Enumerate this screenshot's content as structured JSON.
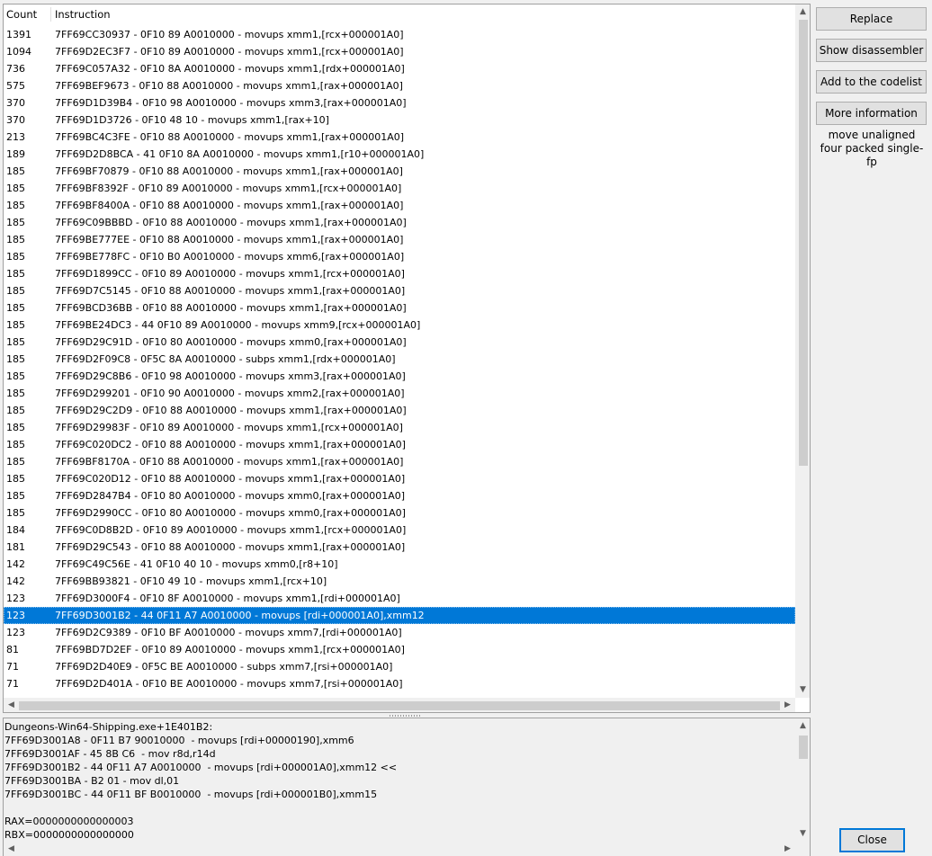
{
  "list": {
    "headers": {
      "count": "Count",
      "instruction": "Instruction"
    },
    "rows": [
      {
        "count": "1391",
        "instruction": "7FF69CC30937 - 0F10 89 A0010000  - movups xmm1,[rcx+000001A0]"
      },
      {
        "count": "1094",
        "instruction": "7FF69D2EC3F7 - 0F10 89 A0010000  - movups xmm1,[rcx+000001A0]"
      },
      {
        "count": "736",
        "instruction": "7FF69C057A32 - 0F10 8A A0010000  - movups xmm1,[rdx+000001A0]"
      },
      {
        "count": "575",
        "instruction": "7FF69BEF9673 - 0F10 88 A0010000  - movups xmm1,[rax+000001A0]"
      },
      {
        "count": "370",
        "instruction": "7FF69D1D39B4 - 0F10 98 A0010000  - movups xmm3,[rax+000001A0]"
      },
      {
        "count": "370",
        "instruction": "7FF69D1D3726 - 0F10 48 10  - movups xmm1,[rax+10]"
      },
      {
        "count": "213",
        "instruction": "7FF69BC4C3FE - 0F10 88 A0010000  - movups xmm1,[rax+000001A0]"
      },
      {
        "count": "189",
        "instruction": "7FF69D2D8BCA - 41 0F10 8A A0010000  - movups xmm1,[r10+000001A0]"
      },
      {
        "count": "185",
        "instruction": "7FF69BF70879 - 0F10 88 A0010000  - movups xmm1,[rax+000001A0]"
      },
      {
        "count": "185",
        "instruction": "7FF69BF8392F - 0F10 89 A0010000  - movups xmm1,[rcx+000001A0]"
      },
      {
        "count": "185",
        "instruction": "7FF69BF8400A - 0F10 88 A0010000  - movups xmm1,[rax+000001A0]"
      },
      {
        "count": "185",
        "instruction": "7FF69C09BBBD - 0F10 88 A0010000  - movups xmm1,[rax+000001A0]"
      },
      {
        "count": "185",
        "instruction": "7FF69BE777EE - 0F10 88 A0010000  - movups xmm1,[rax+000001A0]"
      },
      {
        "count": "185",
        "instruction": "7FF69BE778FC - 0F10 B0 A0010000  - movups xmm6,[rax+000001A0]"
      },
      {
        "count": "185",
        "instruction": "7FF69D1899CC - 0F10 89 A0010000  - movups xmm1,[rcx+000001A0]"
      },
      {
        "count": "185",
        "instruction": "7FF69D7C5145 - 0F10 88 A0010000  - movups xmm1,[rax+000001A0]"
      },
      {
        "count": "185",
        "instruction": "7FF69BCD36BB - 0F10 88 A0010000  - movups xmm1,[rax+000001A0]"
      },
      {
        "count": "185",
        "instruction": "7FF69BE24DC3 - 44 0F10 89 A0010000  - movups xmm9,[rcx+000001A0]"
      },
      {
        "count": "185",
        "instruction": "7FF69D29C91D - 0F10 80 A0010000  - movups xmm0,[rax+000001A0]"
      },
      {
        "count": "185",
        "instruction": "7FF69D2F09C8 - 0F5C 8A A0010000  - subps xmm1,[rdx+000001A0]"
      },
      {
        "count": "185",
        "instruction": "7FF69D29C8B6 - 0F10 98 A0010000  - movups xmm3,[rax+000001A0]"
      },
      {
        "count": "185",
        "instruction": "7FF69D299201 - 0F10 90 A0010000  - movups xmm2,[rax+000001A0]"
      },
      {
        "count": "185",
        "instruction": "7FF69D29C2D9 - 0F10 88 A0010000  - movups xmm1,[rax+000001A0]"
      },
      {
        "count": "185",
        "instruction": "7FF69D29983F - 0F10 89 A0010000  - movups xmm1,[rcx+000001A0]"
      },
      {
        "count": "185",
        "instruction": "7FF69C020DC2 - 0F10 88 A0010000  - movups xmm1,[rax+000001A0]"
      },
      {
        "count": "185",
        "instruction": "7FF69BF8170A - 0F10 88 A0010000  - movups xmm1,[rax+000001A0]"
      },
      {
        "count": "185",
        "instruction": "7FF69C020D12 - 0F10 88 A0010000  - movups xmm1,[rax+000001A0]"
      },
      {
        "count": "185",
        "instruction": "7FF69D2847B4 - 0F10 80 A0010000  - movups xmm0,[rax+000001A0]"
      },
      {
        "count": "185",
        "instruction": "7FF69D2990CC - 0F10 80 A0010000  - movups xmm0,[rax+000001A0]"
      },
      {
        "count": "184",
        "instruction": "7FF69C0D8B2D - 0F10 89 A0010000  - movups xmm1,[rcx+000001A0]"
      },
      {
        "count": "181",
        "instruction": "7FF69D29C543 - 0F10 88 A0010000  - movups xmm1,[rax+000001A0]"
      },
      {
        "count": "142",
        "instruction": "7FF69C49C56E - 41 0F10 40 10  - movups xmm0,[r8+10]"
      },
      {
        "count": "142",
        "instruction": "7FF69BB93821 - 0F10 49 10  - movups xmm1,[rcx+10]"
      },
      {
        "count": "123",
        "instruction": "7FF69D3000F4 - 0F10 8F A0010000  - movups xmm1,[rdi+000001A0]"
      },
      {
        "count": "123",
        "instruction": "7FF69D3001B2 - 44 0F11 A7 A0010000  - movups [rdi+000001A0],xmm12",
        "selected": true
      },
      {
        "count": "123",
        "instruction": "7FF69D2C9389 - 0F10 BF A0010000  - movups xmm7,[rdi+000001A0]"
      },
      {
        "count": "81",
        "instruction": "7FF69BD7D2EF - 0F10 89 A0010000  - movups xmm1,[rcx+000001A0]"
      },
      {
        "count": "71",
        "instruction": "7FF69D2D40E9 - 0F5C BE A0010000  - subps xmm7,[rsi+000001A0]"
      },
      {
        "count": "71",
        "instruction": "7FF69D2D401A - 0F10 BE A0010000  - movups xmm7,[rsi+000001A0]"
      }
    ]
  },
  "buttons": {
    "replace": "Replace",
    "show_disassembler": "Show disassembler",
    "add_to_codelist": "Add to the codelist",
    "more_information": "More information",
    "close": "Close"
  },
  "info_text": "move unaligned four packed single-fp",
  "detail": {
    "lines": [
      "Dungeons-Win64-Shipping.exe+1E401B2:",
      "7FF69D3001A8 - 0F11 B7 90010000  - movups [rdi+00000190],xmm6",
      "7FF69D3001AF - 45 8B C6  - mov r8d,r14d",
      "7FF69D3001B2 - 44 0F11 A7 A0010000  - movups [rdi+000001A0],xmm12 <<",
      "7FF69D3001BA - B2 01 - mov dl,01",
      "7FF69D3001BC - 44 0F11 BF B0010000  - movups [rdi+000001B0],xmm15",
      "",
      "RAX=0000000000000003",
      "RBX=0000000000000000"
    ]
  },
  "icons": {
    "up": "▲",
    "down": "▼",
    "left": "◀",
    "right": "▶"
  },
  "colors": {
    "selection": "#0078d7"
  }
}
